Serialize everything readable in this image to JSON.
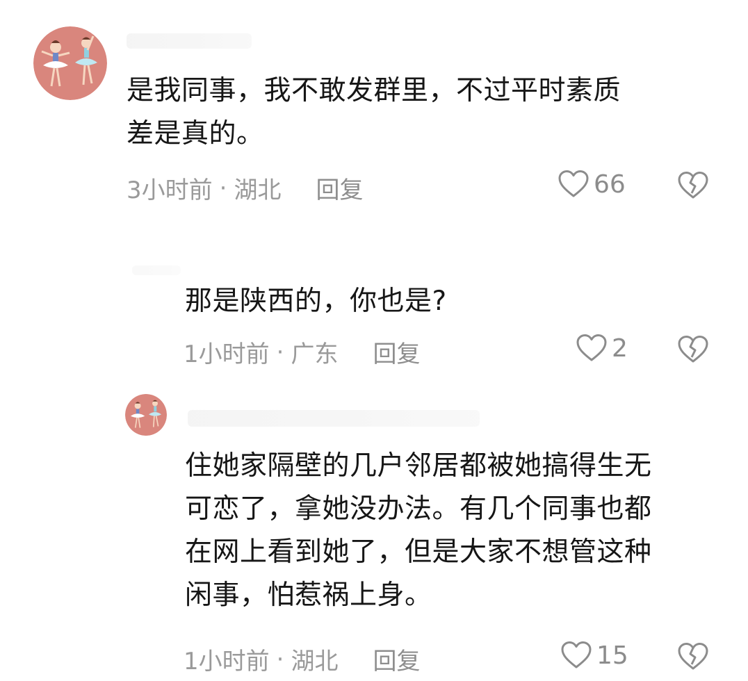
{
  "comments": [
    {
      "text_lines": [
        "是我同事，我不敢发群里，不过平时素质",
        "差是真的。"
      ],
      "time": "3小时前",
      "location": "湖北",
      "reply_label": "回复",
      "likes": "66"
    },
    {
      "text_lines": [
        "那是陕西的，你也是?"
      ],
      "time": "1小时前",
      "location": "广东",
      "reply_label": "回复",
      "likes": "2"
    },
    {
      "text_lines": [
        "住她家隔壁的几户邻居都被她搞得生无",
        "可恋了，拿她没办法。有几个同事也都",
        "在网上看到她了，但是大家不想管这种",
        "闲事，怕惹祸上身。"
      ],
      "time": "1小时前",
      "location": "湖北",
      "reply_label": "回复",
      "likes": "15"
    }
  ],
  "separator": "·",
  "colors": {
    "avatar_bg": "#d9867d",
    "text": "#161616",
    "meta": "#9a9a9a"
  },
  "icons": [
    "heart-outline-icon",
    "broken-heart-icon",
    "avatar-ballerina-icon"
  ]
}
